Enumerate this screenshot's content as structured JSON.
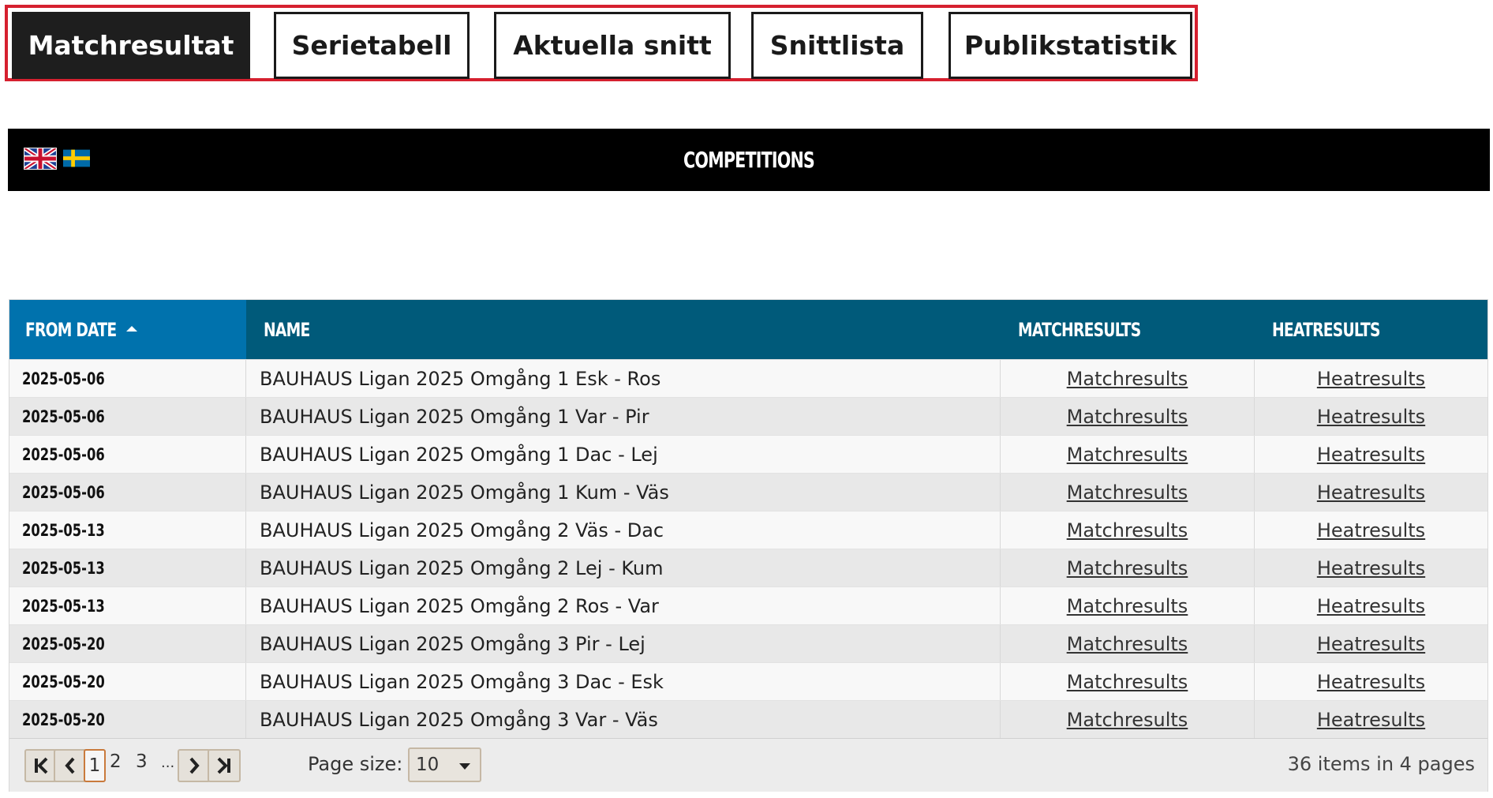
{
  "tabs": [
    {
      "label": "Matchresultat",
      "active": true
    },
    {
      "label": "Serietabell",
      "active": false
    },
    {
      "label": "Aktuella snitt",
      "active": false
    },
    {
      "label": "Snittlista",
      "active": false
    },
    {
      "label": "Publikstatistik",
      "active": false
    }
  ],
  "header": {
    "title": "COMPETITIONS",
    "languages": [
      "english-flag",
      "swedish-flag"
    ]
  },
  "grid": {
    "columns": {
      "from_date": "FROM DATE",
      "name": "NAME",
      "matchresults": "MATCHRESULTS",
      "heatresults": "HEATRESULTS"
    },
    "sort": {
      "column": "from_date",
      "direction": "ascending"
    },
    "rows": [
      {
        "date": "2025-05-06",
        "name": "BAUHAUS Ligan 2025 Omgång 1 Esk - Ros",
        "match": "Matchresults",
        "heat": "Heatresults"
      },
      {
        "date": "2025-05-06",
        "name": "BAUHAUS Ligan 2025 Omgång 1 Var - Pir",
        "match": "Matchresults",
        "heat": "Heatresults"
      },
      {
        "date": "2025-05-06",
        "name": "BAUHAUS Ligan 2025 Omgång 1 Dac - Lej",
        "match": "Matchresults",
        "heat": "Heatresults"
      },
      {
        "date": "2025-05-06",
        "name": "BAUHAUS Ligan 2025 Omgång 1 Kum - Väs",
        "match": "Matchresults",
        "heat": "Heatresults"
      },
      {
        "date": "2025-05-13",
        "name": "BAUHAUS Ligan 2025 Omgång 2 Väs - Dac",
        "match": "Matchresults",
        "heat": "Heatresults"
      },
      {
        "date": "2025-05-13",
        "name": "BAUHAUS Ligan 2025 Omgång 2 Lej - Kum",
        "match": "Matchresults",
        "heat": "Heatresults"
      },
      {
        "date": "2025-05-13",
        "name": "BAUHAUS Ligan 2025 Omgång 2 Ros - Var",
        "match": "Matchresults",
        "heat": "Heatresults"
      },
      {
        "date": "2025-05-20",
        "name": "BAUHAUS Ligan 2025 Omgång 3 Pir - Lej",
        "match": "Matchresults",
        "heat": "Heatresults"
      },
      {
        "date": "2025-05-20",
        "name": "BAUHAUS Ligan 2025 Omgång 3 Dac - Esk",
        "match": "Matchresults",
        "heat": "Heatresults"
      },
      {
        "date": "2025-05-20",
        "name": "BAUHAUS Ligan 2025 Omgång 3 Var - Väs",
        "match": "Matchresults",
        "heat": "Heatresults"
      }
    ]
  },
  "pager": {
    "pages": [
      "1",
      "2",
      "3",
      "..."
    ],
    "current_page": "1",
    "page_size_label": "Page size:",
    "page_size": "10",
    "info": "36 items in 4 pages"
  },
  "colors": {
    "tab_border": "#d6202f",
    "header_bg": "#000000",
    "grid_head": "#005a7a",
    "grid_head_sorted": "#0072ad"
  }
}
